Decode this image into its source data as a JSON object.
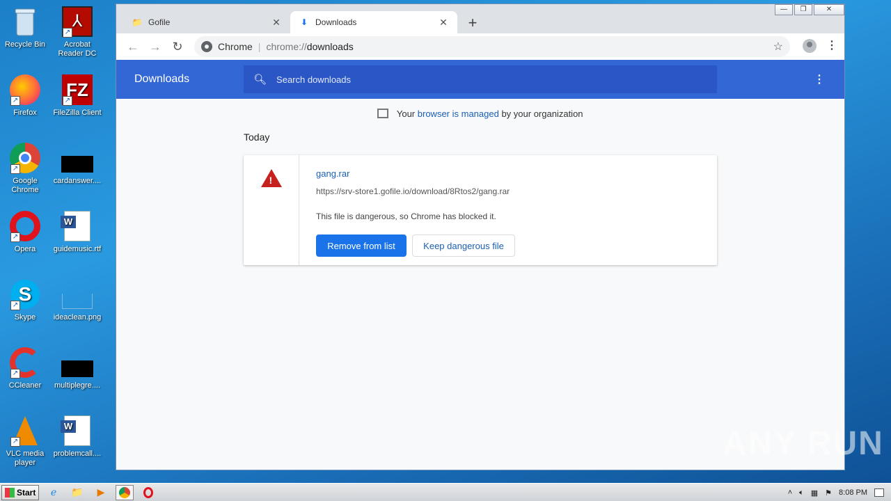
{
  "desktop": {
    "icons": [
      {
        "label": "Recycle Bin",
        "icon": "recycle-bin-icon"
      },
      {
        "label": "Acrobat Reader DC",
        "icon": "acrobat-icon"
      },
      {
        "label": "Firefox",
        "icon": "firefox-icon"
      },
      {
        "label": "FileZilla Client",
        "icon": "filezilla-icon"
      },
      {
        "label": "Google Chrome",
        "icon": "chrome-icon"
      },
      {
        "label": "cardanswer....",
        "icon": "file-icon"
      },
      {
        "label": "Opera",
        "icon": "opera-icon"
      },
      {
        "label": "guidemusic.rtf",
        "icon": "word-doc-icon"
      },
      {
        "label": "Skype",
        "icon": "skype-icon"
      },
      {
        "label": "ideaclean.png",
        "icon": "image-file-icon"
      },
      {
        "label": "CCleaner",
        "icon": "ccleaner-icon"
      },
      {
        "label": "multiplegre....",
        "icon": "file-icon"
      },
      {
        "label": "VLC media player",
        "icon": "vlc-icon"
      },
      {
        "label": "problemcall....",
        "icon": "word-doc-icon"
      }
    ]
  },
  "browser": {
    "tabs": [
      {
        "title": "Gofile",
        "active": false
      },
      {
        "title": "Downloads",
        "active": true
      }
    ],
    "omnibox": {
      "chip": "Chrome",
      "scheme": "chrome://",
      "path": "downloads"
    }
  },
  "downloads": {
    "header_title": "Downloads",
    "search_placeholder": "Search downloads",
    "managed": {
      "prefix": "Your",
      "link": "browser is managed",
      "suffix": "by your organization"
    },
    "date_group": "Today",
    "item": {
      "file_name": "gang.rar",
      "url": "https://srv-store1.gofile.io/download/8Rtos2/gang.rar",
      "status": "This file is dangerous, so Chrome has blocked it.",
      "remove_label": "Remove from list",
      "keep_label": "Keep dangerous file"
    }
  },
  "taskbar": {
    "start_label": "Start",
    "clock": "8:08 PM"
  },
  "watermark": "ANY RUN"
}
